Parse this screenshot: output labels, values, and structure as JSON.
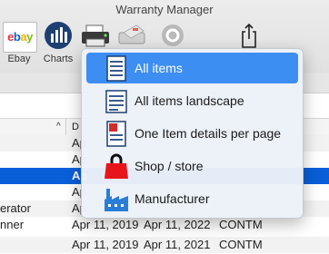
{
  "window": {
    "title": "Warranty Manager"
  },
  "toolbar": {
    "ebay_label": "Ebay",
    "charts_label": "Charts"
  },
  "menu": {
    "items": [
      {
        "label": "All items",
        "icon": "document-icon",
        "selected": true
      },
      {
        "label": "All items landscape",
        "icon": "document-landscape-icon",
        "selected": false
      },
      {
        "label": "One Item details per page",
        "icon": "document-details-icon",
        "selected": false
      },
      {
        "label": "Shop / store",
        "icon": "shopping-bag-icon",
        "selected": false
      },
      {
        "label": "Manufacturer",
        "icon": "factory-icon",
        "selected": false
      }
    ]
  },
  "table": {
    "sort_indicator": "^",
    "date_col_header": "D",
    "rows": [
      {
        "name": "",
        "date1": "Ap",
        "date2": "",
        "code": ""
      },
      {
        "name": "",
        "date1": "Ap",
        "date2": "",
        "code": ""
      },
      {
        "name": "",
        "date1": "Ap",
        "date2": "",
        "code": ""
      },
      {
        "name": "",
        "date1": "Ap",
        "date2": "",
        "code": ""
      },
      {
        "name": "erator",
        "date1": "Ap",
        "date2": "",
        "code": ""
      },
      {
        "name": "nner",
        "date1": "Apr 11, 2019",
        "date2": "Apr 11, 2022",
        "code": "CONTM"
      },
      {
        "name": "",
        "date1": "Apr 11, 2019",
        "date2": "Apr 11, 2021",
        "code": "CONTM"
      }
    ]
  },
  "colors": {
    "selection": "#0a5fd8",
    "menu_highlight": "#3d8ef3"
  }
}
